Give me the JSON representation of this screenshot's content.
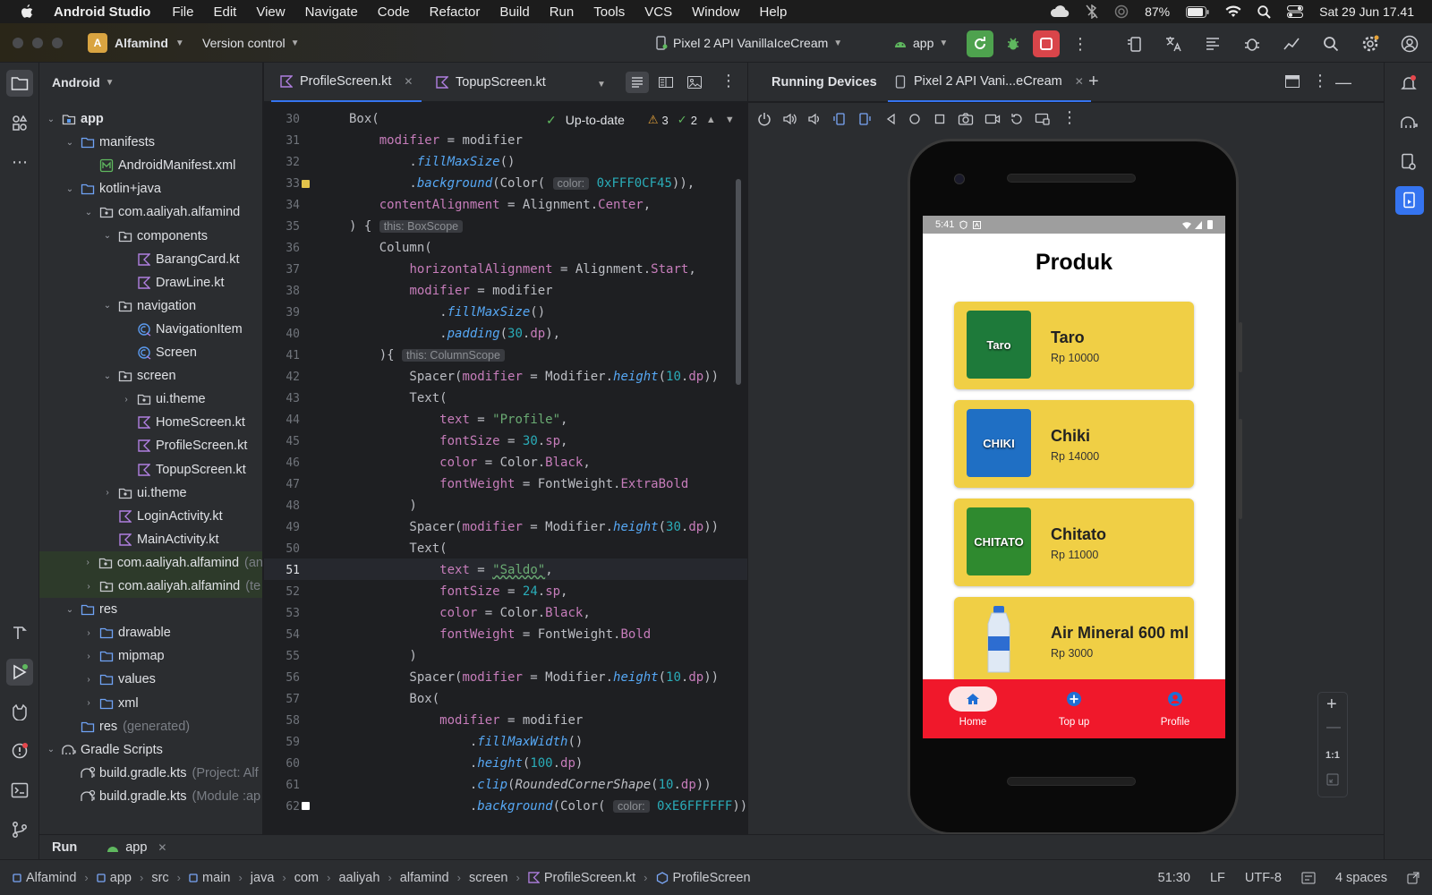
{
  "menubar": {
    "app_name": "Android Studio",
    "items": [
      "File",
      "Edit",
      "View",
      "Navigate",
      "Code",
      "Refactor",
      "Build",
      "Run",
      "Tools",
      "VCS",
      "Window",
      "Help"
    ],
    "battery": "87%",
    "datetime": "Sat 29 Jun  17.41"
  },
  "toolbar": {
    "project_badge": "A",
    "project_name": "Alfamind",
    "vcs_label": "Version control",
    "device": "Pixel 2 API VanillaIceCream",
    "run_config": "app"
  },
  "project_panel": {
    "title": "Android",
    "rows": [
      {
        "label": "app",
        "hint": ""
      },
      {
        "label": "manifests",
        "hint": ""
      },
      {
        "label": "AndroidManifest.xml",
        "hint": ""
      },
      {
        "label": "kotlin+java",
        "hint": ""
      },
      {
        "label": "com.aaliyah.alfamind",
        "hint": ""
      },
      {
        "label": "components",
        "hint": ""
      },
      {
        "label": "BarangCard.kt",
        "hint": ""
      },
      {
        "label": "DrawLine.kt",
        "hint": ""
      },
      {
        "label": "navigation",
        "hint": ""
      },
      {
        "label": "NavigationItem",
        "hint": ""
      },
      {
        "label": "Screen",
        "hint": ""
      },
      {
        "label": "screen",
        "hint": ""
      },
      {
        "label": "ui.theme",
        "hint": ""
      },
      {
        "label": "HomeScreen.kt",
        "hint": ""
      },
      {
        "label": "ProfileScreen.kt",
        "hint": ""
      },
      {
        "label": "TopupScreen.kt",
        "hint": ""
      },
      {
        "label": "ui.theme",
        "hint": ""
      },
      {
        "label": "LoginActivity.kt",
        "hint": ""
      },
      {
        "label": "MainActivity.kt",
        "hint": ""
      },
      {
        "label": "com.aaliyah.alfamind",
        "hint": "(an"
      },
      {
        "label": "com.aaliyah.alfamind",
        "hint": "(te"
      },
      {
        "label": "res",
        "hint": ""
      },
      {
        "label": "drawable",
        "hint": ""
      },
      {
        "label": "mipmap",
        "hint": ""
      },
      {
        "label": "values",
        "hint": ""
      },
      {
        "label": "xml",
        "hint": ""
      },
      {
        "label": "res",
        "hint": "(generated)"
      },
      {
        "label": "Gradle Scripts",
        "hint": ""
      },
      {
        "label": "build.gradle.kts",
        "hint": "(Project: Alf"
      },
      {
        "label": "build.gradle.kts",
        "hint": "(Module :ap"
      }
    ]
  },
  "editor": {
    "tabs": [
      "ProfileScreen.kt",
      "TopupScreen.kt"
    ],
    "inspection": {
      "status": "Up-to-date",
      "warnings": "3",
      "weak": "2"
    },
    "current_line": "51",
    "line_numbers": [
      "30",
      "31",
      "32",
      "33",
      "34",
      "35",
      "36",
      "37",
      "38",
      "39",
      "40",
      "41",
      "42",
      "43",
      "44",
      "45",
      "46",
      "47",
      "48",
      "49",
      "50",
      "51",
      "52",
      "53",
      "54",
      "55",
      "56",
      "57",
      "58",
      "59",
      "60",
      "61",
      "62"
    ],
    "inlay_color": "color:",
    "inlay_box_scope": "this: BoxScope",
    "inlay_column_scope": "this: ColumnScope",
    "hex_color_1": "0xFFF0CF45",
    "hex_color_2": "0xE6FFFFFF",
    "str_profile": "\"Profile\"",
    "str_saldo": "\"Saldo\""
  },
  "running_devices": {
    "title": "Running Devices",
    "tab": "Pixel 2 API Vani...eCream",
    "zoom_label": "1:1"
  },
  "phone": {
    "status_time": "5:41",
    "title": "Produk",
    "products": [
      {
        "name": "Taro",
        "price": "Rp 10000",
        "img_text": "Taro",
        "img_color": "#1e7a3a"
      },
      {
        "name": "Chiki",
        "price": "Rp 14000",
        "img_text": "CHIKI",
        "img_color": "#1f6fc4"
      },
      {
        "name": "Chitato",
        "price": "Rp 11000",
        "img_text": "CHITATO",
        "img_color": "#2f8a2f"
      },
      {
        "name": "Air Mineral 600 ml",
        "price": "Rp 3000",
        "img_text": "",
        "img_color": "#dfe9f5"
      }
    ],
    "nav": [
      "Home",
      "Top up",
      "Profile"
    ]
  },
  "bottom": {
    "run_label": "Run",
    "run_config": "app",
    "breadcrumbs": [
      "Alfamind",
      "app",
      "src",
      "main",
      "java",
      "com",
      "aaliyah",
      "alfamind",
      "screen",
      "ProfileScreen.kt",
      "ProfileScreen"
    ],
    "position": "51:30",
    "line_sep": "LF",
    "encoding": "UTF-8",
    "indent": "4 spaces"
  },
  "colors": {
    "accent": "#3574f0",
    "card_yellow": "#f0cf45",
    "nav_red": "#f0182b",
    "run_green": "#4ea24e",
    "stop_red": "#d9454a"
  }
}
